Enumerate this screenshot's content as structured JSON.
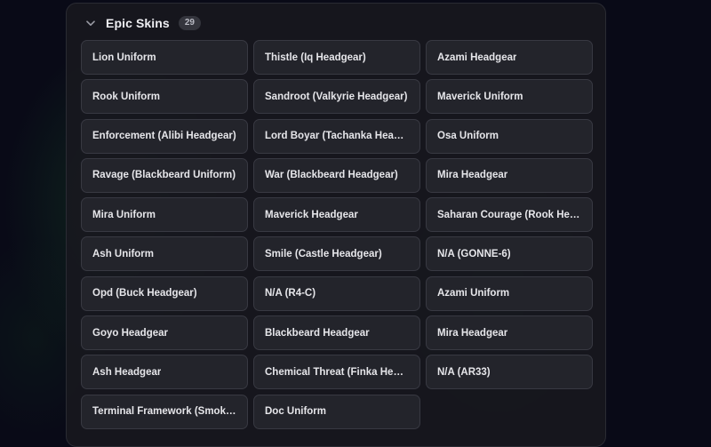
{
  "section": {
    "title": "Epic Skins",
    "count": "29",
    "chevron_icon": "chevron-down-icon",
    "items": [
      "Lion Uniform",
      "Thistle (Iq Headgear)",
      "Azami Headgear",
      "Rook Uniform",
      "Sandroot (Valkyrie Headgear)",
      "Maverick Uniform",
      "Enforcement (Alibi Headgear)",
      "Lord Boyar (Tachanka Headg...",
      "Osa Uniform",
      "Ravage (Blackbeard Uniform)",
      "War (Blackbeard Headgear)",
      "Mira Headgear",
      "Mira Uniform",
      "Maverick Headgear",
      "Saharan Courage (Rook Head...",
      "Ash Uniform",
      "Smile (Castle Headgear)",
      "N/A (GONNE-6)",
      "Opd (Buck Headgear)",
      "N/A (R4-C)",
      "Azami Uniform",
      "Goyo Headgear",
      "Blackbeard Headgear",
      "Mira Headgear",
      "Ash Headgear",
      "Chemical Threat (Finka Head...",
      "N/A (AR33)",
      "Terminal Framework (Smoke ...",
      "Doc Uniform"
    ]
  }
}
